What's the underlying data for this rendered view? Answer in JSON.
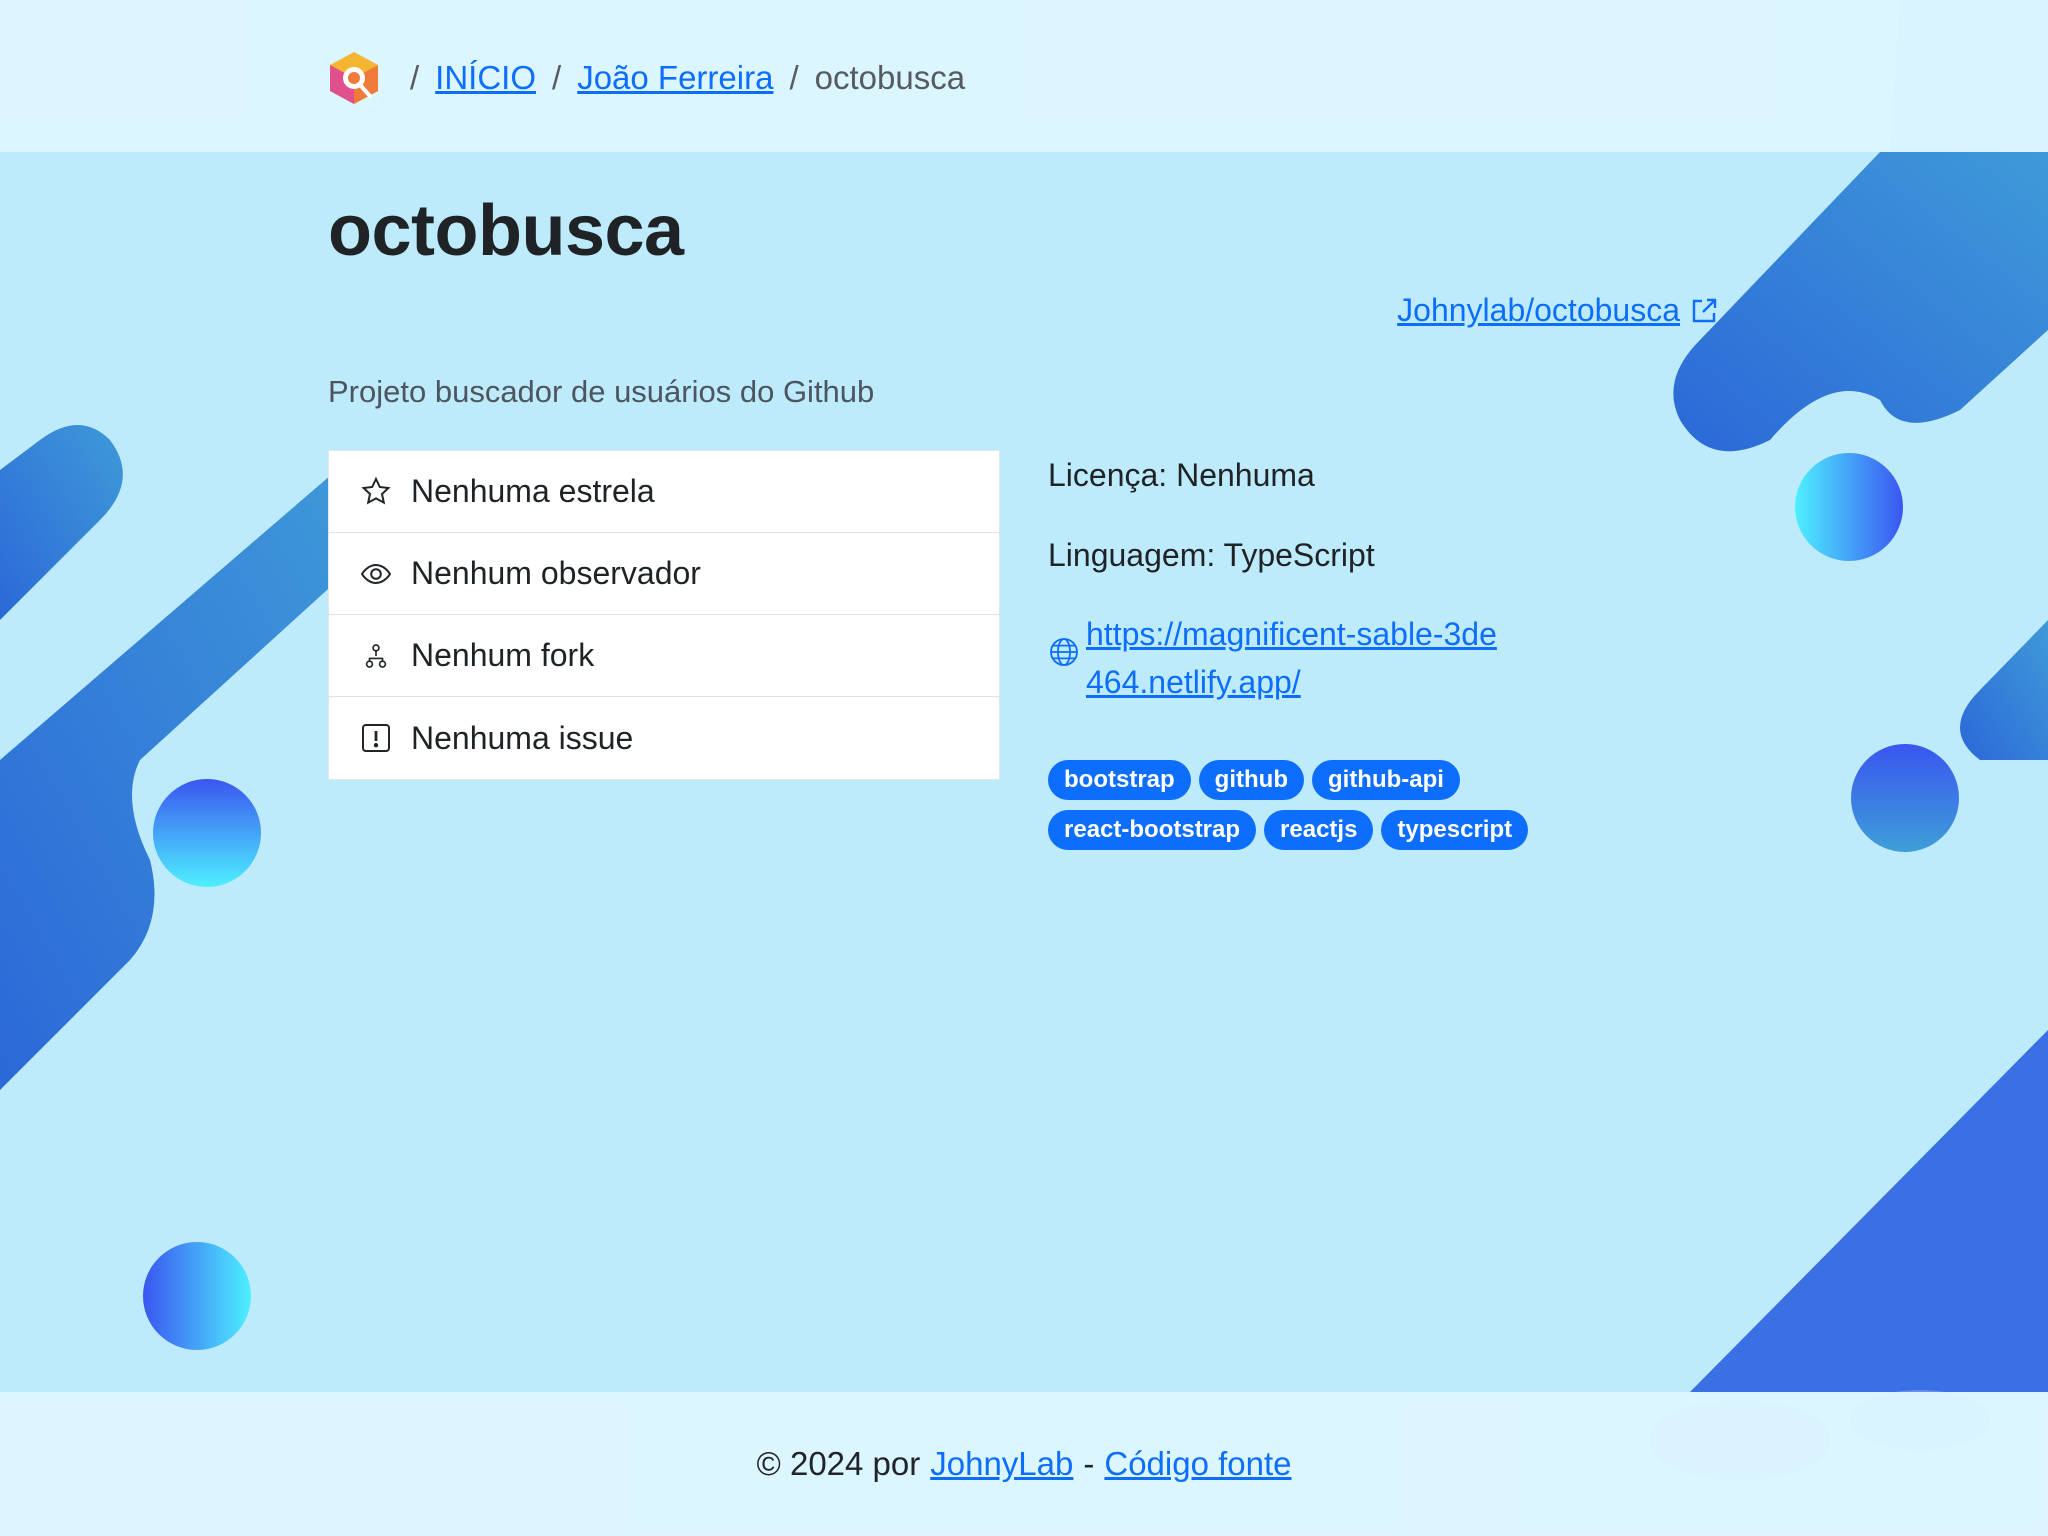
{
  "breadcrumb": {
    "home": "INÍCIO",
    "user": "João Ferreira",
    "current": "octobusca",
    "separator": "/"
  },
  "repo": {
    "title": "octobusca",
    "full_name": "Johnylab/octobusca",
    "description": "Projeto buscador de usuários do Github"
  },
  "stats": [
    {
      "icon": "star-icon",
      "label": "Nenhuma estrela"
    },
    {
      "icon": "eye-icon",
      "label": "Nenhum observador"
    },
    {
      "icon": "fork-icon",
      "label": "Nenhum fork"
    },
    {
      "icon": "issue-icon",
      "label": "Nenhuma issue"
    }
  ],
  "info": {
    "license": "Licença: Nenhuma",
    "language": "Linguagem: TypeScript",
    "homepage": "https://magnificent-sable-3de464.netlify.app/"
  },
  "topics": [
    "bootstrap",
    "github",
    "github-api",
    "react-bootstrap",
    "reactjs",
    "typescript"
  ],
  "footer": {
    "prefix": "© 2024 por",
    "author": "JohnyLab",
    "dash": "-",
    "source": "Código fonte"
  },
  "colors": {
    "background": "#bdebfb",
    "bars": "#def6ff",
    "accent": "#0d6efd",
    "shape_blue": "#2f6fe0"
  }
}
